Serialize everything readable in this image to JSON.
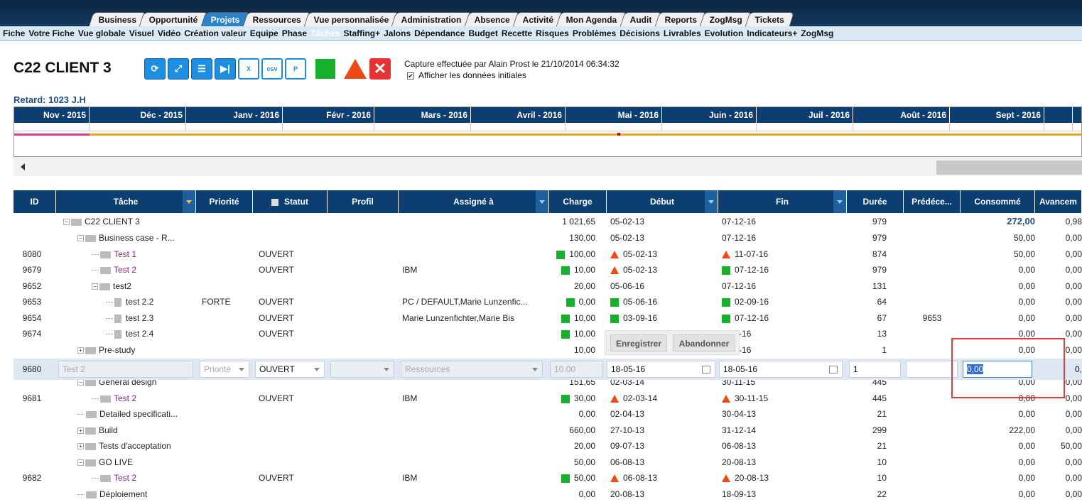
{
  "top_tabs": [
    "Business",
    "Opportunité",
    "Projets",
    "Ressources",
    "Vue personnalisée",
    "Administration",
    "Absence",
    "Activité",
    "Mon Agenda",
    "Audit",
    "Reports",
    "ZogMsg",
    "Tickets"
  ],
  "active_top_tab": "Projets",
  "sub_nav": [
    "Fiche",
    "Votre Fiche",
    "Vue globale",
    "Visuel",
    "Vidéo",
    "Création valeur",
    "Equipe",
    "Phase",
    "Tâches",
    "Staffing+",
    "Jalons",
    "Dépendance",
    "Budget",
    "Recette",
    "Risques",
    "Problèmes",
    "Décisions",
    "Livrables",
    "Evolution",
    "Indicateurs+",
    "ZogMsg"
  ],
  "active_sub_nav": "Tâches",
  "project_title": "C22 CLIENT 3",
  "toolbar": {
    "icons": [
      "refresh-icon",
      "expand-icon",
      "gantt-icon",
      "skip-next-icon",
      "excel-icon",
      "csv-icon",
      "p-icon"
    ],
    "status_green": "#16b02c",
    "status_red": "#f04a14",
    "close_color": "#e63232"
  },
  "capture_text": "Capture effectuée par Alain Prost le 21/10/2014 06:34:32",
  "show_initial_label": "Afficher les données initiales",
  "show_initial_checked": true,
  "retard": "Retard: 1023 J.H",
  "gantt_months": [
    "Nov - 2015",
    "Déc - 2015",
    "Janv - 2016",
    "Févr - 2016",
    "Mars - 2016",
    "Avril - 2016",
    "Mai - 2016",
    "Juin - 2016",
    "Juil - 2016",
    "Août - 2016",
    "Sept - 2016",
    ""
  ],
  "columns": [
    "ID",
    "Tâche",
    "Priorité",
    "Statut",
    "Profil",
    "Assigné à",
    "Charge",
    "Début",
    "Fin",
    "Durée",
    "Prédéce...",
    "Consommé",
    "Avancem"
  ],
  "rows": [
    {
      "id": "",
      "task": "C22 CLIENT 3",
      "prio": "",
      "stat": "",
      "assign": "",
      "charge": "1 021,65",
      "deb": "05-02-13",
      "fin": "07-12-16",
      "dur": "979",
      "pred": "",
      "cons": "272,00",
      "av": "0,98"
    },
    {
      "id": "",
      "task": "Business case - R...",
      "prio": "",
      "stat": "",
      "assign": "",
      "charge": "130,00",
      "deb": "05-02-13",
      "fin": "07-12-16",
      "dur": "979",
      "pred": "",
      "cons": "50,00",
      "av": "0,00"
    },
    {
      "id": "8080",
      "task": "Test 1",
      "prio": "",
      "stat": "OUVERT",
      "assign": "",
      "charge": "100,00",
      "deb": "05-02-13",
      "fin": "11-07-16",
      "dur": "874",
      "pred": "",
      "cons": "50,00",
      "av": "0,00"
    },
    {
      "id": "9679",
      "task": "Test 2",
      "prio": "",
      "stat": "OUVERT",
      "assign": "IBM",
      "charge": "10,00",
      "deb": "05-02-13",
      "fin": "07-12-16",
      "dur": "979",
      "pred": "",
      "cons": "0,00",
      "av": "0,00"
    },
    {
      "id": "9652",
      "task": "test2",
      "prio": "",
      "stat": "",
      "assign": "",
      "charge": "20,00",
      "deb": "05-06-16",
      "fin": "07-12-16",
      "dur": "131",
      "pred": "",
      "cons": "0,00",
      "av": "0,00"
    },
    {
      "id": "9653",
      "task": "test 2.2",
      "prio": "FORTE",
      "stat": "OUVERT",
      "assign": "PC / DEFAULT,Marie Lunzenfic...",
      "charge": "0,00",
      "deb": "05-06-16",
      "fin": "02-09-16",
      "dur": "64",
      "pred": "",
      "cons": "0,00",
      "av": "0,00"
    },
    {
      "id": "9654",
      "task": "test 2.3",
      "prio": "",
      "stat": "OUVERT",
      "assign": "Marie Lunzenfichter,Marie Bis",
      "charge": "10,00",
      "deb": "03-09-16",
      "fin": "07-12-16",
      "dur": "67",
      "pred": "9653",
      "cons": "0,00",
      "av": "0,00"
    },
    {
      "id": "9674",
      "task": "test 2.4",
      "prio": "",
      "stat": "OUVERT",
      "assign": "",
      "charge": "10,00",
      "deb": "",
      "fin": "3-07-16",
      "dur": "13",
      "pred": "",
      "cons": "0,00",
      "av": "0,00"
    },
    {
      "id": "",
      "task": "Pre-study",
      "prio": "",
      "stat": "",
      "assign": "",
      "charge": "10,00",
      "deb": "",
      "fin": "3-05-16",
      "dur": "1",
      "pred": "",
      "cons": "0,00",
      "av": "0,00"
    },
    {
      "id": "",
      "task": "General design",
      "prio": "",
      "stat": "",
      "assign": "",
      "charge": "151,65",
      "deb": "02-03-14",
      "fin": "30-11-15",
      "dur": "445",
      "pred": "",
      "cons": "0,00",
      "av": "0,00"
    },
    {
      "id": "9681",
      "task": "Test 2",
      "prio": "",
      "stat": "OUVERT",
      "assign": "IBM",
      "charge": "30,00",
      "deb": "02-03-14",
      "fin": "30-11-15",
      "dur": "445",
      "pred": "",
      "cons": "0,00",
      "av": "0,00"
    },
    {
      "id": "",
      "task": "Detailed specificati...",
      "prio": "",
      "stat": "",
      "assign": "",
      "charge": "0,00",
      "deb": "02-04-13",
      "fin": "30-04-13",
      "dur": "21",
      "pred": "",
      "cons": "0,00",
      "av": "0,00"
    },
    {
      "id": "",
      "task": "Build",
      "prio": "",
      "stat": "",
      "assign": "",
      "charge": "660,00",
      "deb": "27-10-13",
      "fin": "31-12-14",
      "dur": "299",
      "pred": "",
      "cons": "222,00",
      "av": "0,00"
    },
    {
      "id": "",
      "task": "Tests d'acceptation",
      "prio": "",
      "stat": "",
      "assign": "",
      "charge": "20,00",
      "deb": "09-07-13",
      "fin": "06-08-13",
      "dur": "21",
      "pred": "",
      "cons": "0,00",
      "av": "50,00"
    },
    {
      "id": "",
      "task": "GO LIVE",
      "prio": "",
      "stat": "",
      "assign": "",
      "charge": "50,00",
      "deb": "06-08-13",
      "fin": "20-08-13",
      "dur": "10",
      "pred": "",
      "cons": "0,00",
      "av": "0,00"
    },
    {
      "id": "9682",
      "task": "Test 2",
      "prio": "",
      "stat": "OUVERT",
      "assign": "IBM",
      "charge": "50,00",
      "deb": "06-08-13",
      "fin": "20-08-13",
      "dur": "10",
      "pred": "",
      "cons": "0,00",
      "av": "0,00"
    },
    {
      "id": "",
      "task": "Déploiement",
      "prio": "",
      "stat": "",
      "assign": "",
      "charge": "0,00",
      "deb": "20-08-13",
      "fin": "18-09-13",
      "dur": "22",
      "pred": "",
      "cons": "0,00",
      "av": "0,00"
    }
  ],
  "edit_row": {
    "id": "9680",
    "task_placeholder": "Test 2",
    "prio_placeholder": "Priorité",
    "status": "OUVERT",
    "assign_placeholder": "Ressources",
    "charge": "10.00",
    "debut": "18-05-16",
    "fin": "18-05-16",
    "duree": "1",
    "consomme": "0,00",
    "avancement": "0,"
  },
  "save_label": "Enregistrer",
  "cancel_label": "Abandonner"
}
